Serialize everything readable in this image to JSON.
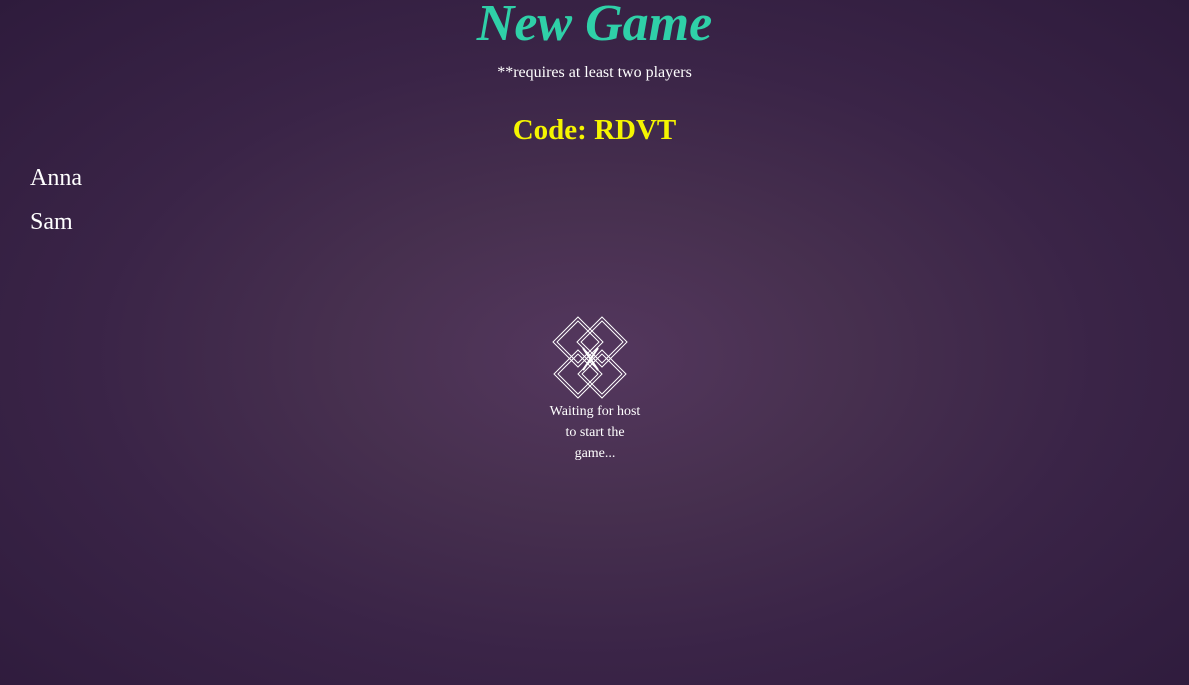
{
  "header": {
    "title": "New Game",
    "subtitle": "**requires at least two players"
  },
  "room": {
    "code_text": "Code: RDVT"
  },
  "players": [
    {
      "name": "Anna"
    },
    {
      "name": "Sam"
    }
  ],
  "status": {
    "icon": "diamond-loader-icon",
    "waiting_text": "Waiting for host to start the game..."
  },
  "colors": {
    "title": "#2fd0a8",
    "code": "#f5f500",
    "background": "#47304f",
    "text": "#ffffff"
  }
}
